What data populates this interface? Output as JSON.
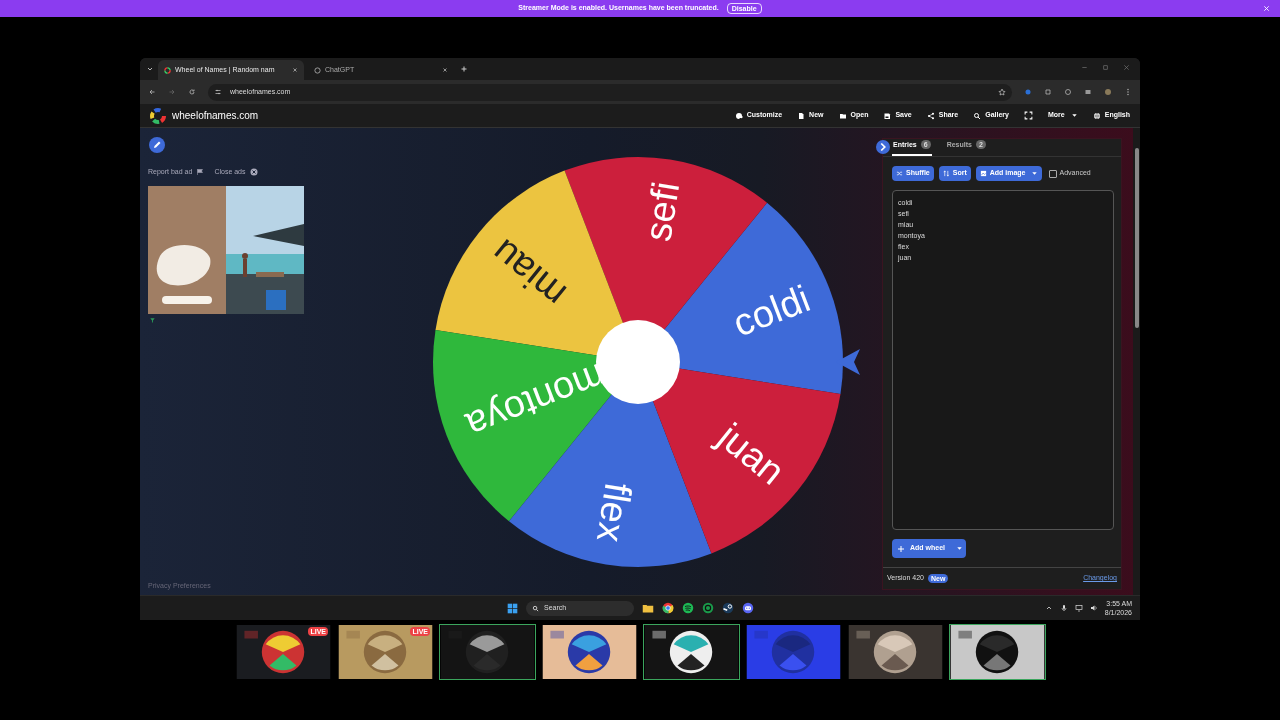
{
  "banner": {
    "message": "Streamer Mode is enabled. Usernames have been truncated.",
    "button": "Disable"
  },
  "browser": {
    "tabs": [
      {
        "title": "Wheel of Names | Random nam",
        "selected": true
      },
      {
        "title": "ChatGPT",
        "selected": false
      }
    ],
    "address": "wheelofnames.com"
  },
  "site": {
    "brand": "wheelofnames.com",
    "nav": [
      {
        "kind": "item",
        "label": "Customize"
      },
      {
        "kind": "item",
        "label": "New"
      },
      {
        "kind": "item",
        "label": "Open"
      },
      {
        "kind": "item",
        "label": "Save"
      },
      {
        "kind": "item",
        "label": "Share"
      },
      {
        "kind": "item",
        "label": "Gallery"
      },
      {
        "kind": "fullscreen"
      },
      {
        "kind": "menu",
        "label": "More"
      },
      {
        "kind": "item",
        "label": "English"
      }
    ]
  },
  "ads": {
    "report": "Report bad ad",
    "close": "Close ads",
    "ad": {
      "kind": "picture"
    },
    "privacy": "Privacy Preferences"
  },
  "wheel": {
    "segments": [
      {
        "label": "coldi",
        "color": "#3e6ad8"
      },
      {
        "label": "sefi",
        "color": "#cc1f3c"
      },
      {
        "label": "miau",
        "color": "#ecc440"
      },
      {
        "label": "montoya",
        "color": "#2fb83c"
      },
      {
        "label": "flex",
        "color": "#3e6ad8"
      },
      {
        "label": "juan",
        "color": "#cc1f3c"
      }
    ]
  },
  "panel": {
    "tabs": [
      {
        "label": "Entries",
        "count": "6",
        "selected": true
      },
      {
        "label": "Results",
        "count": "2",
        "selected": false
      }
    ],
    "buttons": [
      {
        "kind": "button",
        "label": "Shuffle"
      },
      {
        "kind": "button",
        "label": "Sort"
      },
      {
        "kind": "dropdown",
        "label": "Add image"
      }
    ],
    "advanced": {
      "label": "Advanced",
      "checked": false
    },
    "entries": [
      "coldi",
      "sefi",
      "miau",
      "montoya",
      "flex",
      "juan"
    ],
    "add_wheel": "Add wheel",
    "version": "Version 420",
    "version_badge": "New",
    "changelog": "Changelog"
  },
  "taskbar": {
    "search": "Search",
    "time": "3:55 AM",
    "date": "8/1/2026"
  },
  "participants": [
    {
      "kind": "picture",
      "live": "LIVE",
      "speaking": false
    },
    {
      "kind": "picture",
      "live": "LIVE",
      "speaking": false
    },
    {
      "kind": "picture",
      "speaking": true
    },
    {
      "kind": "picture",
      "speaking": false
    },
    {
      "kind": "picture",
      "speaking": true
    },
    {
      "kind": "picture",
      "speaking": false
    },
    {
      "kind": "picture",
      "speaking": false
    },
    {
      "kind": "picture",
      "speaking": true
    }
  ]
}
